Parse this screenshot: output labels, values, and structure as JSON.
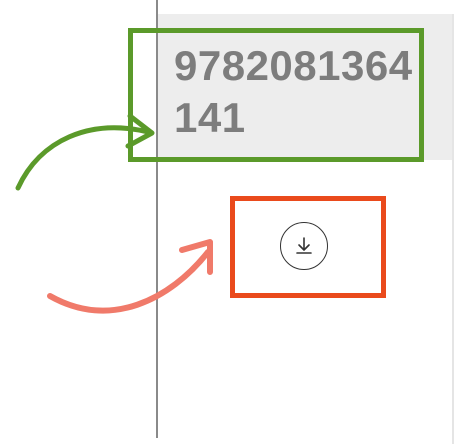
{
  "record": {
    "isbn": "9782081364141"
  },
  "download": {
    "icon": "download-icon"
  },
  "annotations": {
    "green_color": "#5b9a2a",
    "red_color": "#ea4a1c",
    "green_arrow_color": "#5b9a2a",
    "red_arrow_color": "#f07a6a"
  }
}
